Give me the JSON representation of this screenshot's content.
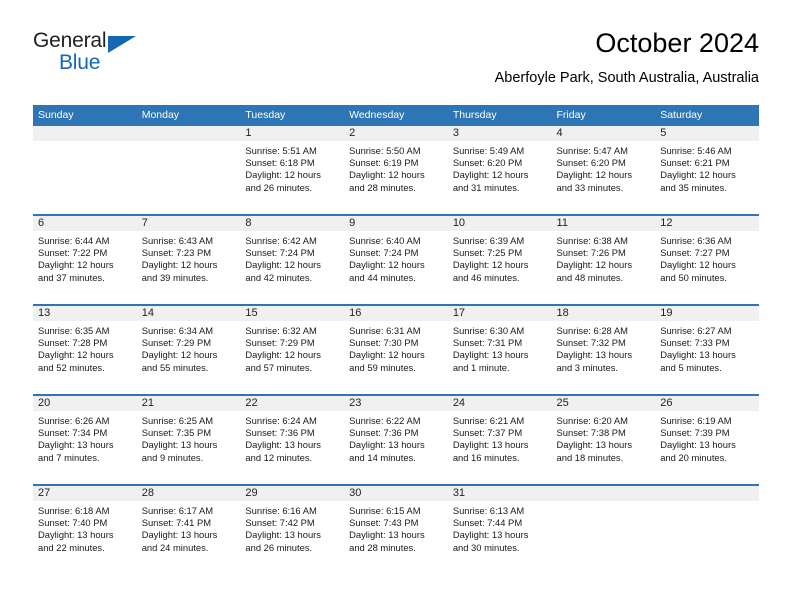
{
  "brand": {
    "name_part1": "General",
    "name_part2": "Blue",
    "triangle_color": "#1368b3",
    "text_color": "#231f20"
  },
  "header": {
    "title": "October 2024",
    "subtitle": "Aberfoyle Park, South Australia, Australia"
  },
  "theme": {
    "header_blue": "#2e75b6",
    "daynum_band": "#f0f0f0",
    "cell_background": "#ffffff",
    "text_color": "#1a1a1a"
  },
  "calendar": {
    "weekday_headers": [
      "Sunday",
      "Monday",
      "Tuesday",
      "Wednesday",
      "Thursday",
      "Friday",
      "Saturday"
    ],
    "weeks": [
      [
        {
          "day": "",
          "sunrise": "",
          "sunset": "",
          "daylight1": "",
          "daylight2": ""
        },
        {
          "day": "",
          "sunrise": "",
          "sunset": "",
          "daylight1": "",
          "daylight2": ""
        },
        {
          "day": "1",
          "sunrise": "Sunrise: 5:51 AM",
          "sunset": "Sunset: 6:18 PM",
          "daylight1": "Daylight: 12 hours",
          "daylight2": "and 26 minutes."
        },
        {
          "day": "2",
          "sunrise": "Sunrise: 5:50 AM",
          "sunset": "Sunset: 6:19 PM",
          "daylight1": "Daylight: 12 hours",
          "daylight2": "and 28 minutes."
        },
        {
          "day": "3",
          "sunrise": "Sunrise: 5:49 AM",
          "sunset": "Sunset: 6:20 PM",
          "daylight1": "Daylight: 12 hours",
          "daylight2": "and 31 minutes."
        },
        {
          "day": "4",
          "sunrise": "Sunrise: 5:47 AM",
          "sunset": "Sunset: 6:20 PM",
          "daylight1": "Daylight: 12 hours",
          "daylight2": "and 33 minutes."
        },
        {
          "day": "5",
          "sunrise": "Sunrise: 5:46 AM",
          "sunset": "Sunset: 6:21 PM",
          "daylight1": "Daylight: 12 hours",
          "daylight2": "and 35 minutes."
        }
      ],
      [
        {
          "day": "6",
          "sunrise": "Sunrise: 6:44 AM",
          "sunset": "Sunset: 7:22 PM",
          "daylight1": "Daylight: 12 hours",
          "daylight2": "and 37 minutes."
        },
        {
          "day": "7",
          "sunrise": "Sunrise: 6:43 AM",
          "sunset": "Sunset: 7:23 PM",
          "daylight1": "Daylight: 12 hours",
          "daylight2": "and 39 minutes."
        },
        {
          "day": "8",
          "sunrise": "Sunrise: 6:42 AM",
          "sunset": "Sunset: 7:24 PM",
          "daylight1": "Daylight: 12 hours",
          "daylight2": "and 42 minutes."
        },
        {
          "day": "9",
          "sunrise": "Sunrise: 6:40 AM",
          "sunset": "Sunset: 7:24 PM",
          "daylight1": "Daylight: 12 hours",
          "daylight2": "and 44 minutes."
        },
        {
          "day": "10",
          "sunrise": "Sunrise: 6:39 AM",
          "sunset": "Sunset: 7:25 PM",
          "daylight1": "Daylight: 12 hours",
          "daylight2": "and 46 minutes."
        },
        {
          "day": "11",
          "sunrise": "Sunrise: 6:38 AM",
          "sunset": "Sunset: 7:26 PM",
          "daylight1": "Daylight: 12 hours",
          "daylight2": "and 48 minutes."
        },
        {
          "day": "12",
          "sunrise": "Sunrise: 6:36 AM",
          "sunset": "Sunset: 7:27 PM",
          "daylight1": "Daylight: 12 hours",
          "daylight2": "and 50 minutes."
        }
      ],
      [
        {
          "day": "13",
          "sunrise": "Sunrise: 6:35 AM",
          "sunset": "Sunset: 7:28 PM",
          "daylight1": "Daylight: 12 hours",
          "daylight2": "and 52 minutes."
        },
        {
          "day": "14",
          "sunrise": "Sunrise: 6:34 AM",
          "sunset": "Sunset: 7:29 PM",
          "daylight1": "Daylight: 12 hours",
          "daylight2": "and 55 minutes."
        },
        {
          "day": "15",
          "sunrise": "Sunrise: 6:32 AM",
          "sunset": "Sunset: 7:29 PM",
          "daylight1": "Daylight: 12 hours",
          "daylight2": "and 57 minutes."
        },
        {
          "day": "16",
          "sunrise": "Sunrise: 6:31 AM",
          "sunset": "Sunset: 7:30 PM",
          "daylight1": "Daylight: 12 hours",
          "daylight2": "and 59 minutes."
        },
        {
          "day": "17",
          "sunrise": "Sunrise: 6:30 AM",
          "sunset": "Sunset: 7:31 PM",
          "daylight1": "Daylight: 13 hours",
          "daylight2": "and 1 minute."
        },
        {
          "day": "18",
          "sunrise": "Sunrise: 6:28 AM",
          "sunset": "Sunset: 7:32 PM",
          "daylight1": "Daylight: 13 hours",
          "daylight2": "and 3 minutes."
        },
        {
          "day": "19",
          "sunrise": "Sunrise: 6:27 AM",
          "sunset": "Sunset: 7:33 PM",
          "daylight1": "Daylight: 13 hours",
          "daylight2": "and 5 minutes."
        }
      ],
      [
        {
          "day": "20",
          "sunrise": "Sunrise: 6:26 AM",
          "sunset": "Sunset: 7:34 PM",
          "daylight1": "Daylight: 13 hours",
          "daylight2": "and 7 minutes."
        },
        {
          "day": "21",
          "sunrise": "Sunrise: 6:25 AM",
          "sunset": "Sunset: 7:35 PM",
          "daylight1": "Daylight: 13 hours",
          "daylight2": "and 9 minutes."
        },
        {
          "day": "22",
          "sunrise": "Sunrise: 6:24 AM",
          "sunset": "Sunset: 7:36 PM",
          "daylight1": "Daylight: 13 hours",
          "daylight2": "and 12 minutes."
        },
        {
          "day": "23",
          "sunrise": "Sunrise: 6:22 AM",
          "sunset": "Sunset: 7:36 PM",
          "daylight1": "Daylight: 13 hours",
          "daylight2": "and 14 minutes."
        },
        {
          "day": "24",
          "sunrise": "Sunrise: 6:21 AM",
          "sunset": "Sunset: 7:37 PM",
          "daylight1": "Daylight: 13 hours",
          "daylight2": "and 16 minutes."
        },
        {
          "day": "25",
          "sunrise": "Sunrise: 6:20 AM",
          "sunset": "Sunset: 7:38 PM",
          "daylight1": "Daylight: 13 hours",
          "daylight2": "and 18 minutes."
        },
        {
          "day": "26",
          "sunrise": "Sunrise: 6:19 AM",
          "sunset": "Sunset: 7:39 PM",
          "daylight1": "Daylight: 13 hours",
          "daylight2": "and 20 minutes."
        }
      ],
      [
        {
          "day": "27",
          "sunrise": "Sunrise: 6:18 AM",
          "sunset": "Sunset: 7:40 PM",
          "daylight1": "Daylight: 13 hours",
          "daylight2": "and 22 minutes."
        },
        {
          "day": "28",
          "sunrise": "Sunrise: 6:17 AM",
          "sunset": "Sunset: 7:41 PM",
          "daylight1": "Daylight: 13 hours",
          "daylight2": "and 24 minutes."
        },
        {
          "day": "29",
          "sunrise": "Sunrise: 6:16 AM",
          "sunset": "Sunset: 7:42 PM",
          "daylight1": "Daylight: 13 hours",
          "daylight2": "and 26 minutes."
        },
        {
          "day": "30",
          "sunrise": "Sunrise: 6:15 AM",
          "sunset": "Sunset: 7:43 PM",
          "daylight1": "Daylight: 13 hours",
          "daylight2": "and 28 minutes."
        },
        {
          "day": "31",
          "sunrise": "Sunrise: 6:13 AM",
          "sunset": "Sunset: 7:44 PM",
          "daylight1": "Daylight: 13 hours",
          "daylight2": "and 30 minutes."
        },
        {
          "day": "",
          "sunrise": "",
          "sunset": "",
          "daylight1": "",
          "daylight2": ""
        },
        {
          "day": "",
          "sunrise": "",
          "sunset": "",
          "daylight1": "",
          "daylight2": ""
        }
      ]
    ]
  }
}
